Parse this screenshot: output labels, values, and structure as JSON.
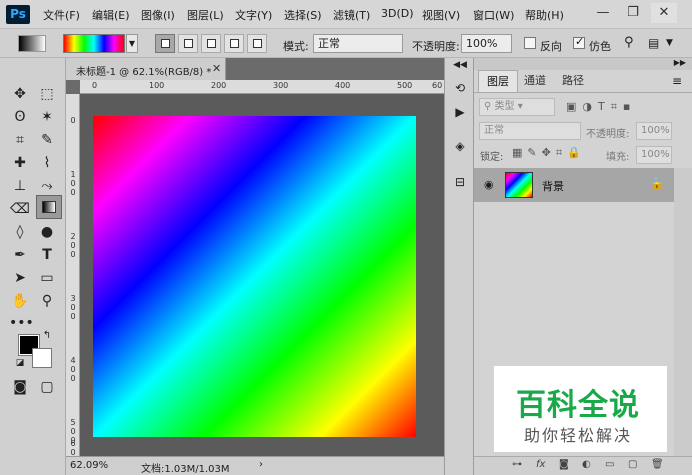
{
  "menubar": {
    "logo": "Ps",
    "items": [
      "文件(F)",
      "编辑(E)",
      "图像(I)",
      "图层(L)",
      "文字(Y)",
      "选择(S)",
      "滤镜(T)",
      "3D(D)",
      "视图(V)",
      "窗口(W)",
      "帮助(H)"
    ]
  },
  "window_controls": {
    "minimize": "—",
    "restore": "❐",
    "close": "✕"
  },
  "options": {
    "mode_label": "模式:",
    "mode_value": "正常",
    "opacity_label": "不透明度:",
    "opacity_value": "100%",
    "reverse_label": "反向",
    "dither_label": "仿色",
    "reverse_checked": false,
    "dither_checked": true
  },
  "document": {
    "tab_title": "未标题-1 @ 62.1%(RGB/8) *",
    "h_ruler": [
      "0",
      "100",
      "200",
      "300",
      "400",
      "500",
      "60"
    ],
    "v_ruler": [
      "0",
      "1\n0\n0",
      "2\n0\n0",
      "3\n0\n0",
      "4\n0\n0",
      "5\n0\n0",
      "6\n0"
    ],
    "zoom": "62.09%",
    "doc_info": "文档:1.03M/1.03M"
  },
  "layers_panel": {
    "tabs": [
      "图层",
      "通道",
      "路径"
    ],
    "filter_placeholder": "类型",
    "blend_mode": "正常",
    "opacity_label": "不透明度:",
    "opacity_value": "100%",
    "lock_label": "锁定:",
    "fill_label": "填充:",
    "fill_value": "100%",
    "layer_name": "背景"
  },
  "watermark": {
    "title": "百科全说",
    "subtitle": "助你轻松解决"
  }
}
